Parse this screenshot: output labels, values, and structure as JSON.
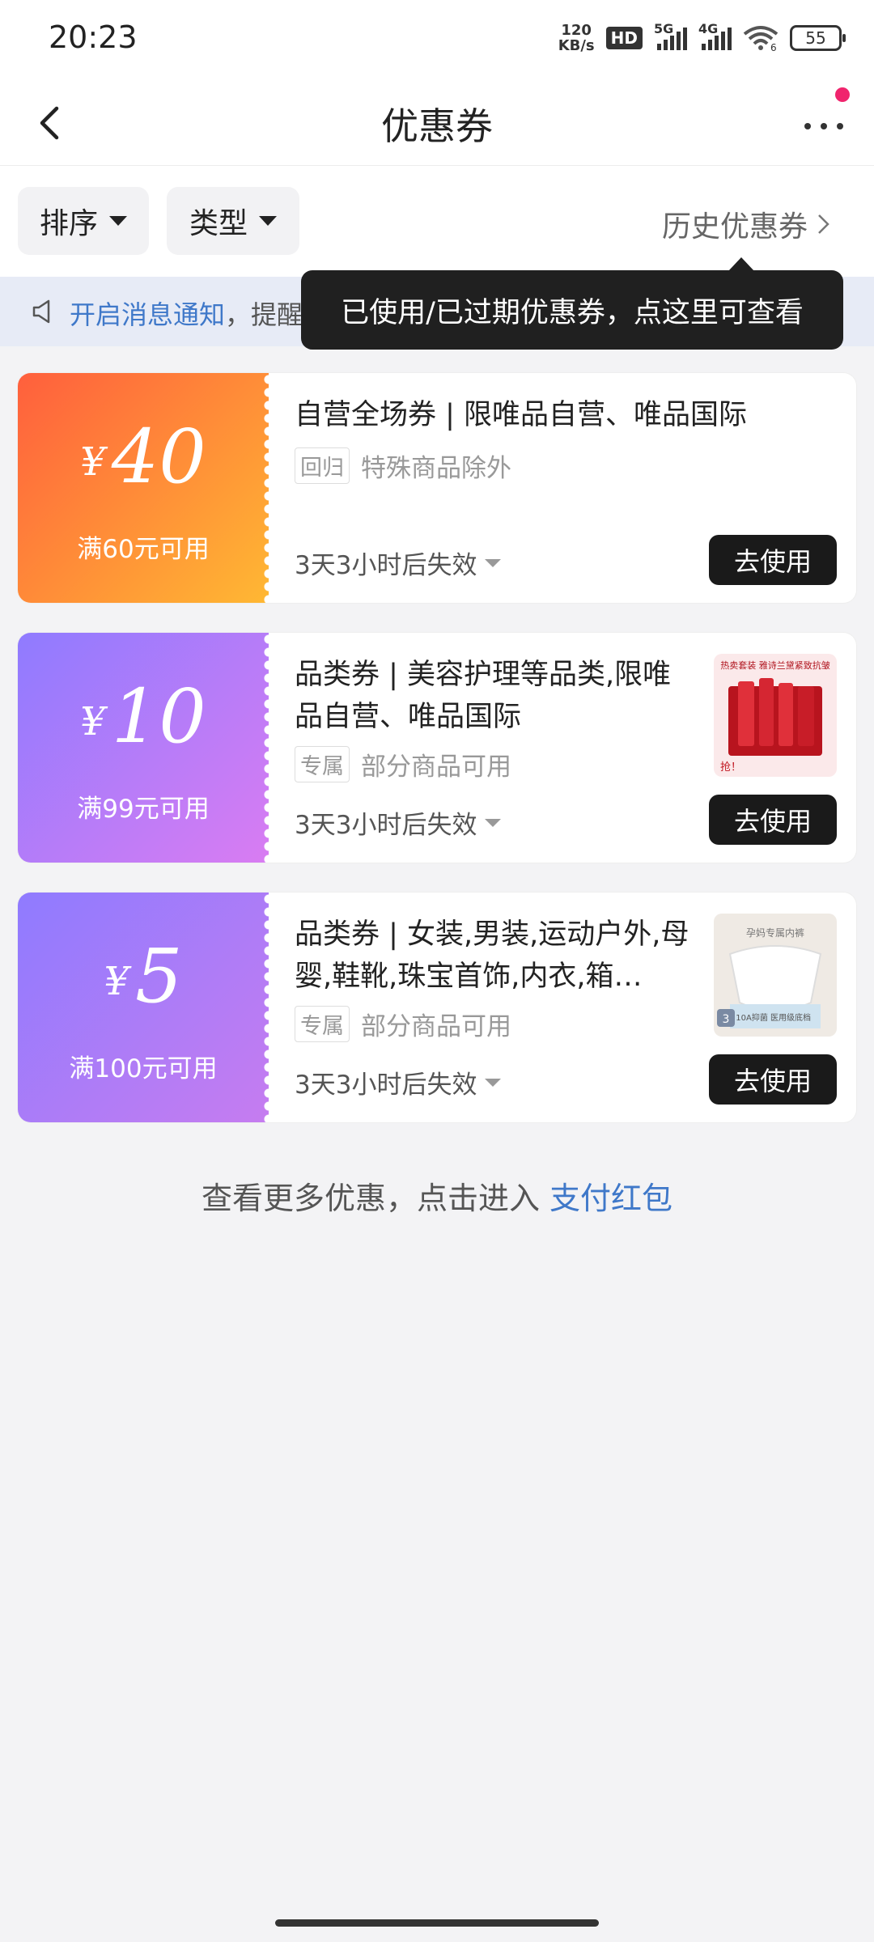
{
  "status_bar": {
    "time": "20:23",
    "net_speed_value": "120",
    "net_speed_unit": "KB/s",
    "hd_label": "HD",
    "sig1_label": "5G",
    "sig2_label": "4G",
    "wifi_label": "6",
    "battery": "55"
  },
  "header": {
    "title": "优惠券",
    "back_icon": "chevron-left-icon",
    "more_icon": "more-dots-icon",
    "dot_color": "#f0246d"
  },
  "filters": {
    "sort_label": "排序",
    "type_label": "类型",
    "history_label": "历史优惠券"
  },
  "notice": {
    "link_text": "开启消息通知",
    "rest_text": "，提醒"
  },
  "tooltip": {
    "text": "已使用/已过期优惠券，点这里可查看"
  },
  "coupons": [
    {
      "currency": "¥",
      "amount": "40",
      "condition": "满60元可用",
      "title": "自营全场券 | 限唯品自营、唯品国际",
      "tag": "回归",
      "scope": "特殊商品除外",
      "expiry": "3天3小时后失效",
      "button": "去使用",
      "gradient": [
        "#ff6a3d",
        "#ffb433"
      ]
    },
    {
      "currency": "¥",
      "amount": "10",
      "condition": "满99元可用",
      "title": "品类券 | 美容护理等品类,限唯品自营、唯品国际",
      "tag": "专属",
      "scope": "部分商品可用",
      "expiry": "3天3小时后失效",
      "button": "去使用",
      "thumb_text_top": "热卖套装 雅诗兰黛紧致抗皱",
      "thumb_text_bottom": "抢！",
      "gradient": [
        "#9b7bff",
        "#d77cf2"
      ]
    },
    {
      "currency": "¥",
      "amount": "5",
      "condition": "满100元可用",
      "title": "品类券 | 女装,男装,运动户外,母婴,鞋靴,珠宝首饰,内衣,箱…",
      "tag": "专属",
      "scope": "部分商品可用",
      "expiry": "3天3小时后失效",
      "button": "去使用",
      "thumb_text_top": "孕妈专属内裤",
      "thumb_text_bottom": "10A抑菌 医用级底档",
      "thumb_badge": "3",
      "gradient": [
        "#9b7bff",
        "#c77cf0"
      ]
    }
  ],
  "footer": {
    "text": "查看更多优惠，点击进入 ",
    "link": "支付红包"
  }
}
